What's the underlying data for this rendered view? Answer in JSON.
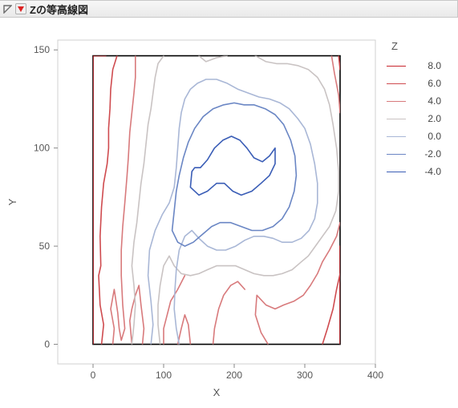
{
  "header": {
    "title": "Zの等高線図"
  },
  "chart_data": {
    "type": "contour",
    "title": "",
    "xlabel": "X",
    "ylabel": "Y",
    "legend_title": "Z",
    "xlim": [
      -50,
      400
    ],
    "ylim": [
      -10,
      155
    ],
    "x_ticks": [
      0,
      100,
      200,
      300,
      400
    ],
    "y_ticks": [
      0,
      50,
      100,
      150
    ],
    "data_box": {
      "x0": 0,
      "x1": 350,
      "y0": 0,
      "y1": 147
    },
    "levels": [
      {
        "z": 8.0,
        "color": "#c8262d",
        "paths": [
          [
            [
              0,
              0
            ],
            [
              0,
              147
            ]
          ],
          [
            [
              0,
              147
            ],
            [
              18,
              147
            ]
          ],
          [
            [
              350,
              50
            ],
            [
              350,
              0
            ]
          ]
        ]
      },
      {
        "z": 6.0,
        "color": "#cf4b4f",
        "paths": [
          [
            [
              12,
              0
            ],
            [
              15,
              10
            ],
            [
              10,
              20
            ],
            [
              8,
              35
            ],
            [
              11,
              40
            ],
            [
              10,
              55
            ],
            [
              12,
              70
            ],
            [
              15,
              82
            ],
            [
              20,
              92
            ],
            [
              22,
              100
            ],
            [
              22,
              110
            ],
            [
              24,
              120
            ],
            [
              25,
              130
            ],
            [
              28,
              140
            ],
            [
              34,
              147
            ]
          ],
          [
            [
              348,
              147
            ],
            [
              350,
              140
            ]
          ],
          [
            [
              350,
              36
            ],
            [
              345,
              28
            ],
            [
              340,
              18
            ],
            [
              332,
              8
            ],
            [
              325,
              0
            ]
          ]
        ]
      },
      {
        "z": 4.0,
        "color": "#d87a7c",
        "paths": [
          [
            [
              28,
              0
            ],
            [
              30,
              8
            ],
            [
              25,
              18
            ],
            [
              30,
              28
            ],
            [
              35,
              16
            ],
            [
              37,
              8
            ],
            [
              40,
              2
            ],
            [
              45,
              8
            ],
            [
              42,
              20
            ],
            [
              40,
              35
            ],
            [
              40,
              48
            ],
            [
              42,
              60
            ],
            [
              45,
              72
            ],
            [
              48,
              85
            ],
            [
              50,
              95
            ],
            [
              52,
              108
            ],
            [
              55,
              118
            ],
            [
              58,
              128
            ],
            [
              60,
              136
            ],
            [
              60,
              147
            ]
          ],
          [
            [
              70,
              0
            ],
            [
              72,
              8
            ],
            [
              68,
              20
            ],
            [
              65,
              30
            ],
            [
              60,
              25
            ],
            [
              55,
              18
            ],
            [
              52,
              12
            ],
            [
              55,
              0
            ]
          ],
          [
            [
              338,
              147
            ],
            [
              342,
              138
            ],
            [
              348,
              127
            ],
            [
              350,
              118
            ]
          ],
          [
            [
              350,
              62
            ],
            [
              345,
              55
            ],
            [
              335,
              48
            ],
            [
              325,
              42
            ],
            [
              318,
              36
            ],
            [
              308,
              30
            ],
            [
              298,
              25
            ],
            [
              285,
              22
            ],
            [
              270,
              20
            ],
            [
              258,
              18
            ],
            [
              245,
              20
            ],
            [
              232,
              25
            ],
            [
              230,
              15
            ],
            [
              238,
              6
            ],
            [
              248,
              0
            ]
          ],
          [
            [
              215,
              28
            ],
            [
              205,
              32
            ],
            [
              195,
              30
            ],
            [
              185,
              25
            ],
            [
              178,
              18
            ],
            [
              172,
              8
            ],
            [
              170,
              0
            ]
          ],
          [
            [
              130,
              35
            ],
            [
              120,
              28
            ],
            [
              110,
              22
            ],
            [
              105,
              15
            ],
            [
              100,
              8
            ],
            [
              100,
              0
            ]
          ],
          [
            [
              120,
              0
            ],
            [
              125,
              8
            ],
            [
              130,
              15
            ],
            [
              135,
              10
            ],
            [
              138,
              0
            ]
          ]
        ]
      },
      {
        "z": 2.0,
        "color": "#c9c3c3",
        "paths": [
          [
            [
              55,
              0
            ],
            [
              58,
              10
            ],
            [
              60,
              20
            ],
            [
              58,
              30
            ],
            [
              55,
              40
            ],
            [
              58,
              52
            ],
            [
              62,
              62
            ],
            [
              65,
              72
            ],
            [
              68,
              82
            ],
            [
              72,
              92
            ],
            [
              75,
              102
            ],
            [
              78,
              112
            ],
            [
              82,
              120
            ],
            [
              85,
              128
            ],
            [
              88,
              136
            ],
            [
              92,
              143
            ],
            [
              100,
              147
            ]
          ],
          [
            [
              150,
              147
            ],
            [
              160,
              144
            ],
            [
              175,
              146
            ],
            [
              190,
              147
            ]
          ],
          [
            [
              230,
              147
            ],
            [
              245,
              144
            ],
            [
              260,
              143
            ],
            [
              275,
              143
            ],
            [
              290,
              142
            ],
            [
              305,
              140
            ],
            [
              318,
              136
            ],
            [
              328,
              130
            ],
            [
              335,
              122
            ],
            [
              340,
              112
            ],
            [
              345,
              100
            ],
            [
              348,
              88
            ],
            [
              348,
              78
            ],
            [
              344,
              68
            ],
            [
              335,
              60
            ],
            [
              325,
              55
            ],
            [
              315,
              50
            ],
            [
              305,
              45
            ],
            [
              295,
              42
            ],
            [
              282,
              38
            ],
            [
              268,
              36
            ],
            [
              255,
              35
            ],
            [
              242,
              35
            ],
            [
              228,
              36
            ],
            [
              215,
              38
            ],
            [
              202,
              40
            ],
            [
              188,
              40
            ],
            [
              175,
              40
            ],
            [
              162,
              38
            ],
            [
              150,
              36
            ],
            [
              138,
              35
            ],
            [
              125,
              36
            ],
            [
              115,
              40
            ],
            [
              108,
              45
            ],
            [
              100,
              40
            ],
            [
              95,
              30
            ],
            [
              92,
              20
            ],
            [
              92,
              10
            ],
            [
              95,
              0
            ]
          ]
        ]
      },
      {
        "z": 0.0,
        "color": "#a9b7d6",
        "paths": [
          [
            [
              82,
              0
            ],
            [
              85,
              10
            ],
            [
              82,
              22
            ],
            [
              78,
              35
            ],
            [
              80,
              48
            ],
            [
              88,
              58
            ],
            [
              98,
              66
            ],
            [
              108,
              72
            ],
            [
              115,
              80
            ],
            [
              118,
              90
            ],
            [
              120,
              100
            ],
            [
              122,
              110
            ],
            [
              125,
              118
            ],
            [
              130,
              125
            ],
            [
              138,
              130
            ],
            [
              148,
              133
            ],
            [
              160,
              135
            ],
            [
              175,
              135
            ],
            [
              190,
              133
            ],
            [
              205,
              130
            ],
            [
              220,
              128
            ],
            [
              235,
              126
            ],
            [
              250,
              125
            ],
            [
              265,
              123
            ],
            [
              278,
              120
            ],
            [
              290,
              115
            ],
            [
              300,
              110
            ],
            [
              308,
              102
            ],
            [
              314,
              92
            ],
            [
              318,
              82
            ],
            [
              318,
              72
            ],
            [
              314,
              64
            ],
            [
              306,
              58
            ],
            [
              295,
              54
            ],
            [
              282,
              52
            ],
            [
              268,
              52
            ],
            [
              255,
              54
            ],
            [
              242,
              55
            ],
            [
              228,
              55
            ],
            [
              215,
              53
            ],
            [
              202,
              50
            ],
            [
              188,
              48
            ],
            [
              175,
              48
            ],
            [
              162,
              50
            ],
            [
              150,
              54
            ],
            [
              140,
              58
            ],
            [
              130,
              55
            ],
            [
              122,
              48
            ],
            [
              118,
              38
            ],
            [
              116,
              28
            ],
            [
              115,
              18
            ],
            [
              118,
              8
            ],
            [
              122,
              0
            ]
          ]
        ]
      },
      {
        "z": -2.0,
        "color": "#6a86c4",
        "paths": [
          [
            [
              112,
              58
            ],
            [
              120,
              52
            ],
            [
              130,
              50
            ],
            [
              142,
              52
            ],
            [
              155,
              56
            ],
            [
              168,
              60
            ],
            [
              180,
              62
            ],
            [
              195,
              62
            ],
            [
              210,
              60
            ],
            [
              225,
              58
            ],
            [
              240,
              58
            ],
            [
              255,
              60
            ],
            [
              268,
              64
            ],
            [
              278,
              70
            ],
            [
              285,
              78
            ],
            [
              288,
              86
            ],
            [
              286,
              96
            ],
            [
              280,
              104
            ],
            [
              270,
              112
            ],
            [
              258,
              117
            ],
            [
              244,
              120
            ],
            [
              228,
              122
            ],
            [
              214,
              122
            ],
            [
              200,
              123
            ],
            [
              185,
              122
            ],
            [
              170,
              120
            ],
            [
              156,
              116
            ],
            [
              144,
              110
            ],
            [
              135,
              103
            ],
            [
              128,
              95
            ],
            [
              122,
              86
            ],
            [
              118,
              78
            ],
            [
              115,
              68
            ],
            [
              112,
              58
            ]
          ]
        ]
      },
      {
        "z": -4.0,
        "color": "#3a5db6",
        "paths": [
          [
            [
              138,
              80
            ],
            [
              150,
              76
            ],
            [
              162,
              78
            ],
            [
              175,
              82
            ],
            [
              186,
              82
            ],
            [
              198,
              78
            ],
            [
              210,
              76
            ],
            [
              225,
              78
            ],
            [
              238,
              82
            ],
            [
              250,
              86
            ],
            [
              258,
              92
            ],
            [
              258,
              100
            ],
            [
              250,
              96
            ],
            [
              240,
              93
            ],
            [
              228,
              95
            ],
            [
              218,
              100
            ],
            [
              208,
              104
            ],
            [
              196,
              106
            ],
            [
              184,
              104
            ],
            [
              172,
              100
            ],
            [
              162,
              94
            ],
            [
              152,
              90
            ],
            [
              144,
              90
            ],
            [
              140,
              88
            ],
            [
              138,
              80
            ]
          ]
        ]
      }
    ]
  }
}
